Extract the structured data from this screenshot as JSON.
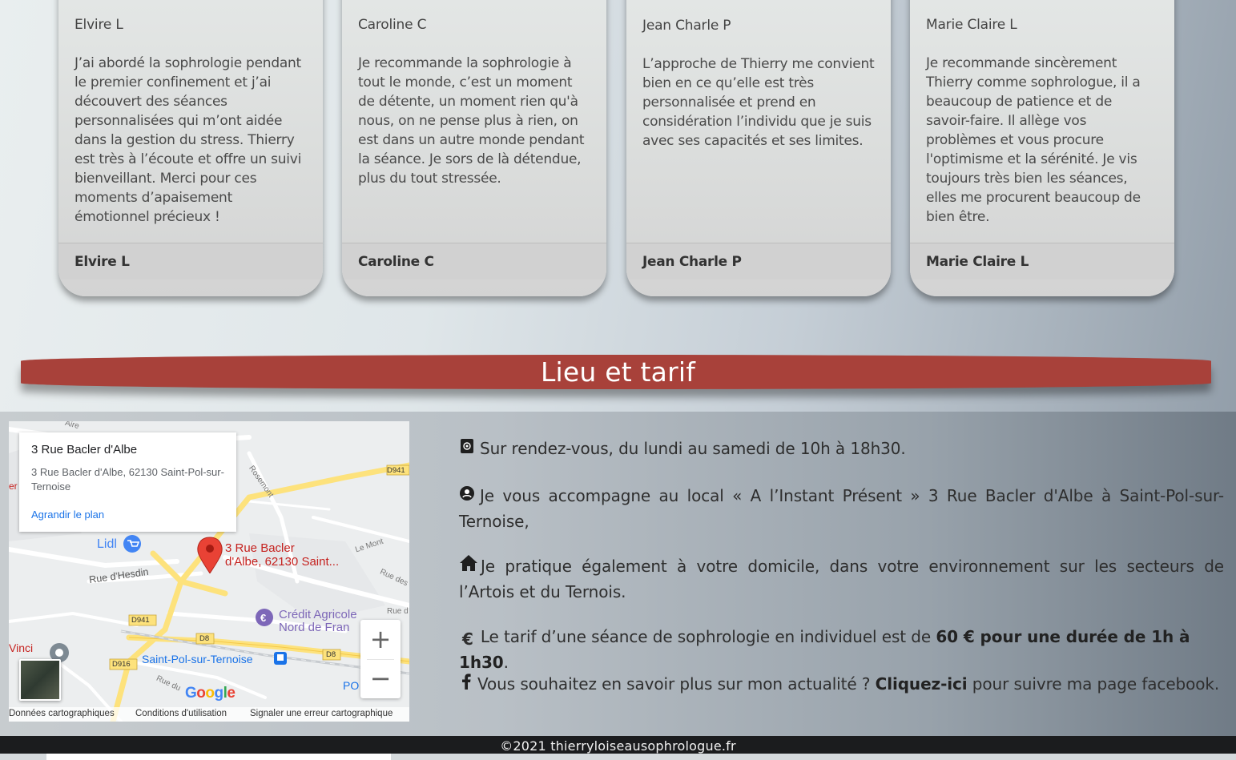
{
  "testimonials": [
    {
      "author": "Elvire L",
      "text": "J’ai abordé la sophrologie pendant le premier confinement et j’ai découvert des séances personnalisées qui m’ont aidée dans la gestion du stress. Thierry est très à l’écoute et offre un suivi bienveillant. Merci pour ces moments d’apaisement émotionnel précieux !"
    },
    {
      "author": "Caroline C",
      "text": "Je recommande la sophrologie à tout le monde, c’est un moment de détente, un moment rien qu'à nous, on ne pense plus à rien, on est dans un autre monde pendant la séance. Je sors de là détendue, plus du tout stressée."
    },
    {
      "author": "Jean Charle P",
      "text": "L’approche de Thierry me convient bien en ce qu’elle est très personnalisée et prend en considération l’individu que je suis avec ses capacités et ses limites."
    },
    {
      "author": "Marie Claire L",
      "text": "Je recommande sincèrement Thierry comme sophrologue, il a beaucoup de patience et de savoir-faire. Il allège vos problèmes et vous procure l'optimisme et la sérénité. Je vis toujours très bien les séances, elles me procurent beaucoup de bien être."
    }
  ],
  "section": {
    "title": "Lieu et tarif",
    "banner_color": "#a8413a"
  },
  "map": {
    "info_title": "3 Rue Bacler d'Albe",
    "info_address": "3 Rue Bacler d'Albe, 62130 Saint-Pol-sur-Ternoise",
    "enlarge_link": "Agrandir le plan",
    "marker_label_line1": "3 Rue Bacler",
    "marker_label_line2": "d'Albe, 62130 Saint...",
    "labels": {
      "lidl": "Lidl",
      "rue_hesdin": "Rue d'Hesdin",
      "credit_agricole_1": "Crédit Agricole",
      "credit_agricole_2": "Nord de Fran",
      "saint_pol": "Saint-Pol-sur-Ternoise",
      "vinci": "Vinci",
      "le_mont": "Le Mont",
      "rosemont": "Rosemont",
      "rue_des": "Rue des",
      "rue_d": "Rue d",
      "rue_du": "Rue du",
      "aire": "Aire",
      "er": "er",
      "po": "PO",
      "d941": "D941",
      "d941b": "D941",
      "d8": "D8",
      "d8b": "D8",
      "d916": "D916",
      "google": "Google"
    },
    "zoom_in": "+",
    "zoom_out": "−",
    "footer": {
      "data": "Données cartographiques",
      "terms": "Conditions d'utilisation",
      "report": "Signaler une erreur cartographique"
    }
  },
  "info": {
    "p1_text": "Sur rendez-vous, du lundi au samedi de 10h à 18h30.",
    "p2_text": "Je vous accompagne au local « A l’Instant Présent » 3 Rue Bacler d'Albe à Saint-Pol-sur-Ternoise,",
    "p3_text": "Je pratique également à votre domicile, dans votre environnement sur les secteurs de l’Artois et du Ternois.",
    "p4_pre": "Le tarif d’une séance de sophrologie en individuel est de ",
    "p4_bold": "60 € pour une durée de 1h à 1h30",
    "p4_post": ".",
    "p4_icon": "€",
    "p5_pre": "Vous souhaitez en savoir plus sur mon actualité ? ",
    "p5_link": "Cliquez-ici",
    "p5_post": " pour suivre ma page facebook.",
    "icons": [
      "email-icon",
      "location-pin-icon",
      "home-icon",
      "euro-icon",
      "facebook-icon"
    ]
  },
  "footer": {
    "copyright": "©2021 thierryloiseausophrologue.fr"
  }
}
